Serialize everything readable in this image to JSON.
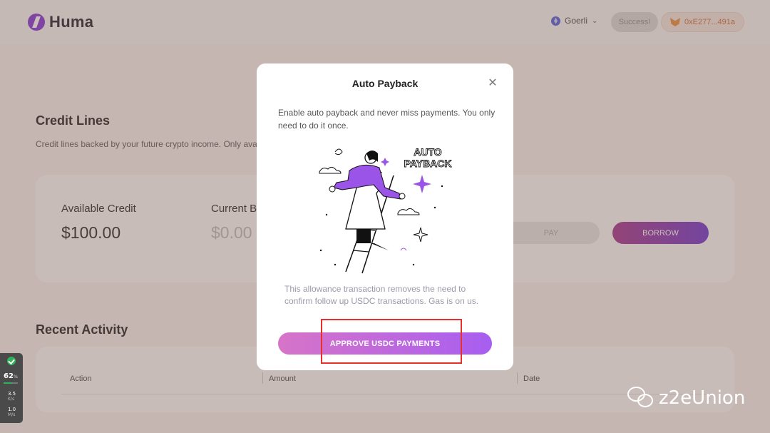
{
  "header": {
    "logo_text": "Huma",
    "network": "Goerli",
    "status_label": "Success!",
    "wallet_address": "0xE277...491a"
  },
  "credit_lines": {
    "title": "Credit Lines",
    "subtitle": "Credit lines backed by your future crypto income. Only ava",
    "available_credit_label": "Available Credit",
    "available_credit_value": "$100.00",
    "current_balance_label": "Current B",
    "current_balance_value": "$0.00",
    "pay_label": "PAY",
    "borrow_label": "BORROW"
  },
  "recent_activity": {
    "title": "Recent Activity",
    "columns": [
      "Action",
      "Amount",
      "Date"
    ]
  },
  "modal": {
    "title": "Auto Payback",
    "description": "Enable auto payback and never miss payments. You only need to do it once.",
    "illustration_text": "AUTO PAYBACK",
    "note": "This allowance transaction removes the need to confirm follow up USDC transactions. Gas is on us.",
    "approve_label": "APPROVE USDC PAYMENTS"
  },
  "perf_widget": {
    "cpu": "62",
    "cpu_unit": "%",
    "cpu_fraction": 0.62,
    "up_value": "3.5",
    "up_unit": "K/s",
    "down_value": "1.0",
    "down_unit": "M/s"
  },
  "watermark": {
    "text": "z2eUnion"
  },
  "colors": {
    "brand_purple": "#7d2fd6",
    "highlight_red": "#e8302a",
    "approve_gradient_start": "#d774c8",
    "approve_gradient_end": "#a75ef0"
  }
}
